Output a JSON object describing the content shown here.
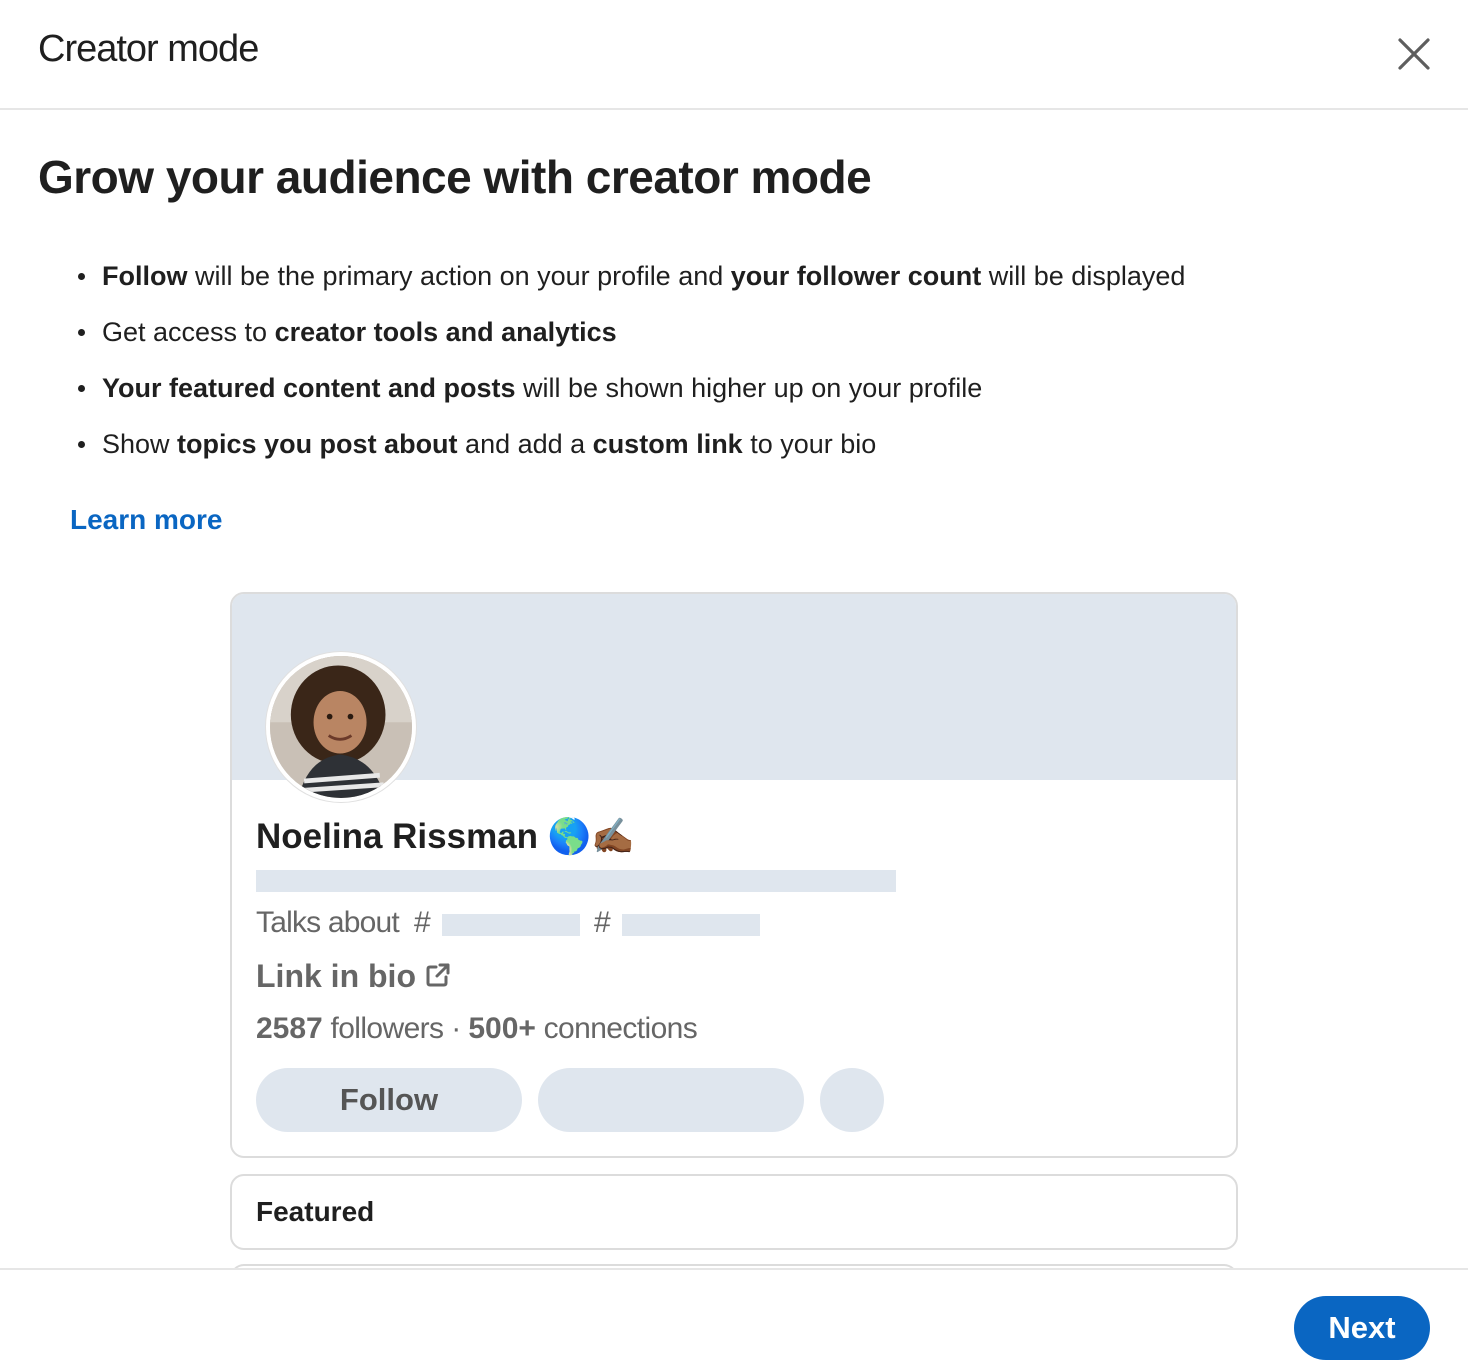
{
  "dialog": {
    "title": "Creator mode",
    "close_icon": "close-icon"
  },
  "intro": {
    "headline": "Grow your audience with creator mode",
    "bullets": [
      [
        {
          "text": "Follow",
          "bold": true
        },
        {
          "text": " will be the primary action on your profile and ",
          "bold": false
        },
        {
          "text": "your follower count",
          "bold": true
        },
        {
          "text": " will be displayed",
          "bold": false
        }
      ],
      [
        {
          "text": "Get access to ",
          "bold": false
        },
        {
          "text": "creator tools and analytics",
          "bold": true
        }
      ],
      [
        {
          "text": "Your featured content and posts",
          "bold": true
        },
        {
          "text": " will be shown higher up on your profile",
          "bold": false
        }
      ],
      [
        {
          "text": "Show ",
          "bold": false
        },
        {
          "text": "topics you post about",
          "bold": true
        },
        {
          "text": " and add a ",
          "bold": false
        },
        {
          "text": "custom link",
          "bold": true
        },
        {
          "text": " to your bio",
          "bold": false
        }
      ]
    ],
    "learn_more": "Learn more"
  },
  "profile_preview": {
    "name": "Noelina Rissman 🌎✍🏾",
    "talks_about": "Talks about",
    "hash_symbol": "#",
    "link_in_bio": "Link in bio",
    "link_icon": "external-link-icon",
    "followers_count": "2587",
    "followers_label": " followers · ",
    "connections_count": "500+",
    "connections_label": " connections",
    "follow_button": "Follow",
    "cover_color": "#dfe6ee"
  },
  "featured": {
    "title": "Featured"
  },
  "footer": {
    "next_button": "Next"
  },
  "colors": {
    "accent": "#0a66c2",
    "placeholder": "#dfe6ee"
  }
}
